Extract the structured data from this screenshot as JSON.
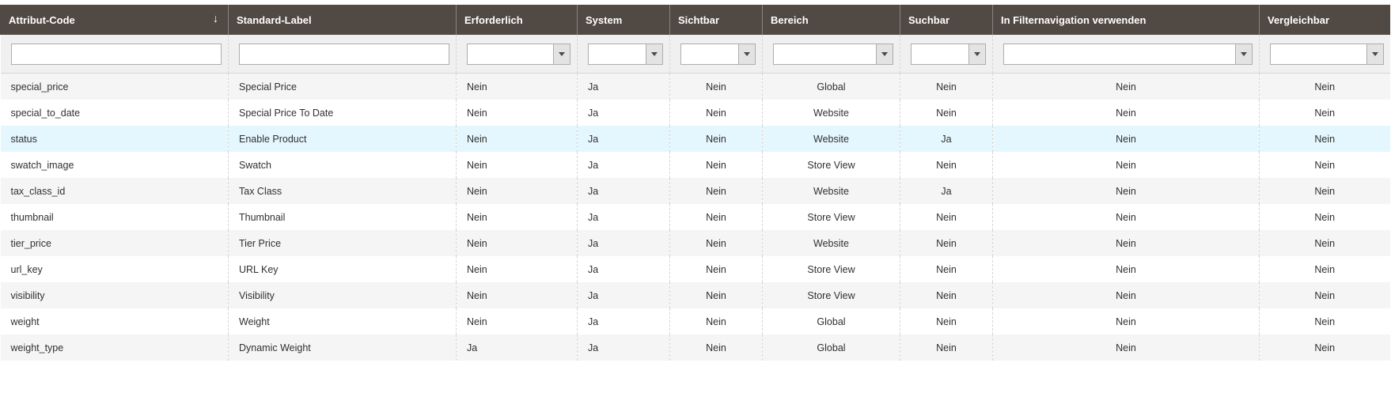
{
  "columns": [
    {
      "label": "Attribut-Code",
      "sort_icon": "sort-down-arrow-icon",
      "sort_glyph": "↓"
    },
    {
      "label": "Standard-Label"
    },
    {
      "label": "Erforderlich"
    },
    {
      "label": "System"
    },
    {
      "label": "Sichtbar"
    },
    {
      "label": "Bereich"
    },
    {
      "label": "Suchbar"
    },
    {
      "label": "In Filternavigation verwenden"
    },
    {
      "label": "Vergleichbar"
    }
  ],
  "filters": {
    "attribute_code": "",
    "default_label": "",
    "required": "",
    "system": "",
    "visible": "",
    "scope": "",
    "searchable": "",
    "filterable": "",
    "comparable": ""
  },
  "rows": [
    [
      "special_price",
      "Special Price",
      "Nein",
      "Ja",
      "Nein",
      "Global",
      "Nein",
      "Nein",
      "Nein"
    ],
    [
      "special_to_date",
      "Special Price To Date",
      "Nein",
      "Ja",
      "Nein",
      "Website",
      "Nein",
      "Nein",
      "Nein"
    ],
    [
      "status",
      "Enable Product",
      "Nein",
      "Ja",
      "Nein",
      "Website",
      "Ja",
      "Nein",
      "Nein"
    ],
    [
      "swatch_image",
      "Swatch",
      "Nein",
      "Ja",
      "Nein",
      "Store View",
      "Nein",
      "Nein",
      "Nein"
    ],
    [
      "tax_class_id",
      "Tax Class",
      "Nein",
      "Ja",
      "Nein",
      "Website",
      "Ja",
      "Nein",
      "Nein"
    ],
    [
      "thumbnail",
      "Thumbnail",
      "Nein",
      "Ja",
      "Nein",
      "Store View",
      "Nein",
      "Nein",
      "Nein"
    ],
    [
      "tier_price",
      "Tier Price",
      "Nein",
      "Ja",
      "Nein",
      "Website",
      "Nein",
      "Nein",
      "Nein"
    ],
    [
      "url_key",
      "URL Key",
      "Nein",
      "Ja",
      "Nein",
      "Store View",
      "Nein",
      "Nein",
      "Nein"
    ],
    [
      "visibility",
      "Visibility",
      "Nein",
      "Ja",
      "Nein",
      "Store View",
      "Nein",
      "Nein",
      "Nein"
    ],
    [
      "weight",
      "Weight",
      "Nein",
      "Ja",
      "Nein",
      "Global",
      "Nein",
      "Nein",
      "Nein"
    ],
    [
      "weight_type",
      "Dynamic Weight",
      "Ja",
      "Ja",
      "Nein",
      "Global",
      "Nein",
      "Nein",
      "Nein"
    ]
  ],
  "highlighted_row": 2,
  "colors": {
    "header_bg": "#514943",
    "header_text": "#ffffff",
    "filter_bg": "#f0f0f0",
    "row_alt_bg": "#f5f5f5",
    "row_highlight_bg": "#e5f7fe"
  }
}
